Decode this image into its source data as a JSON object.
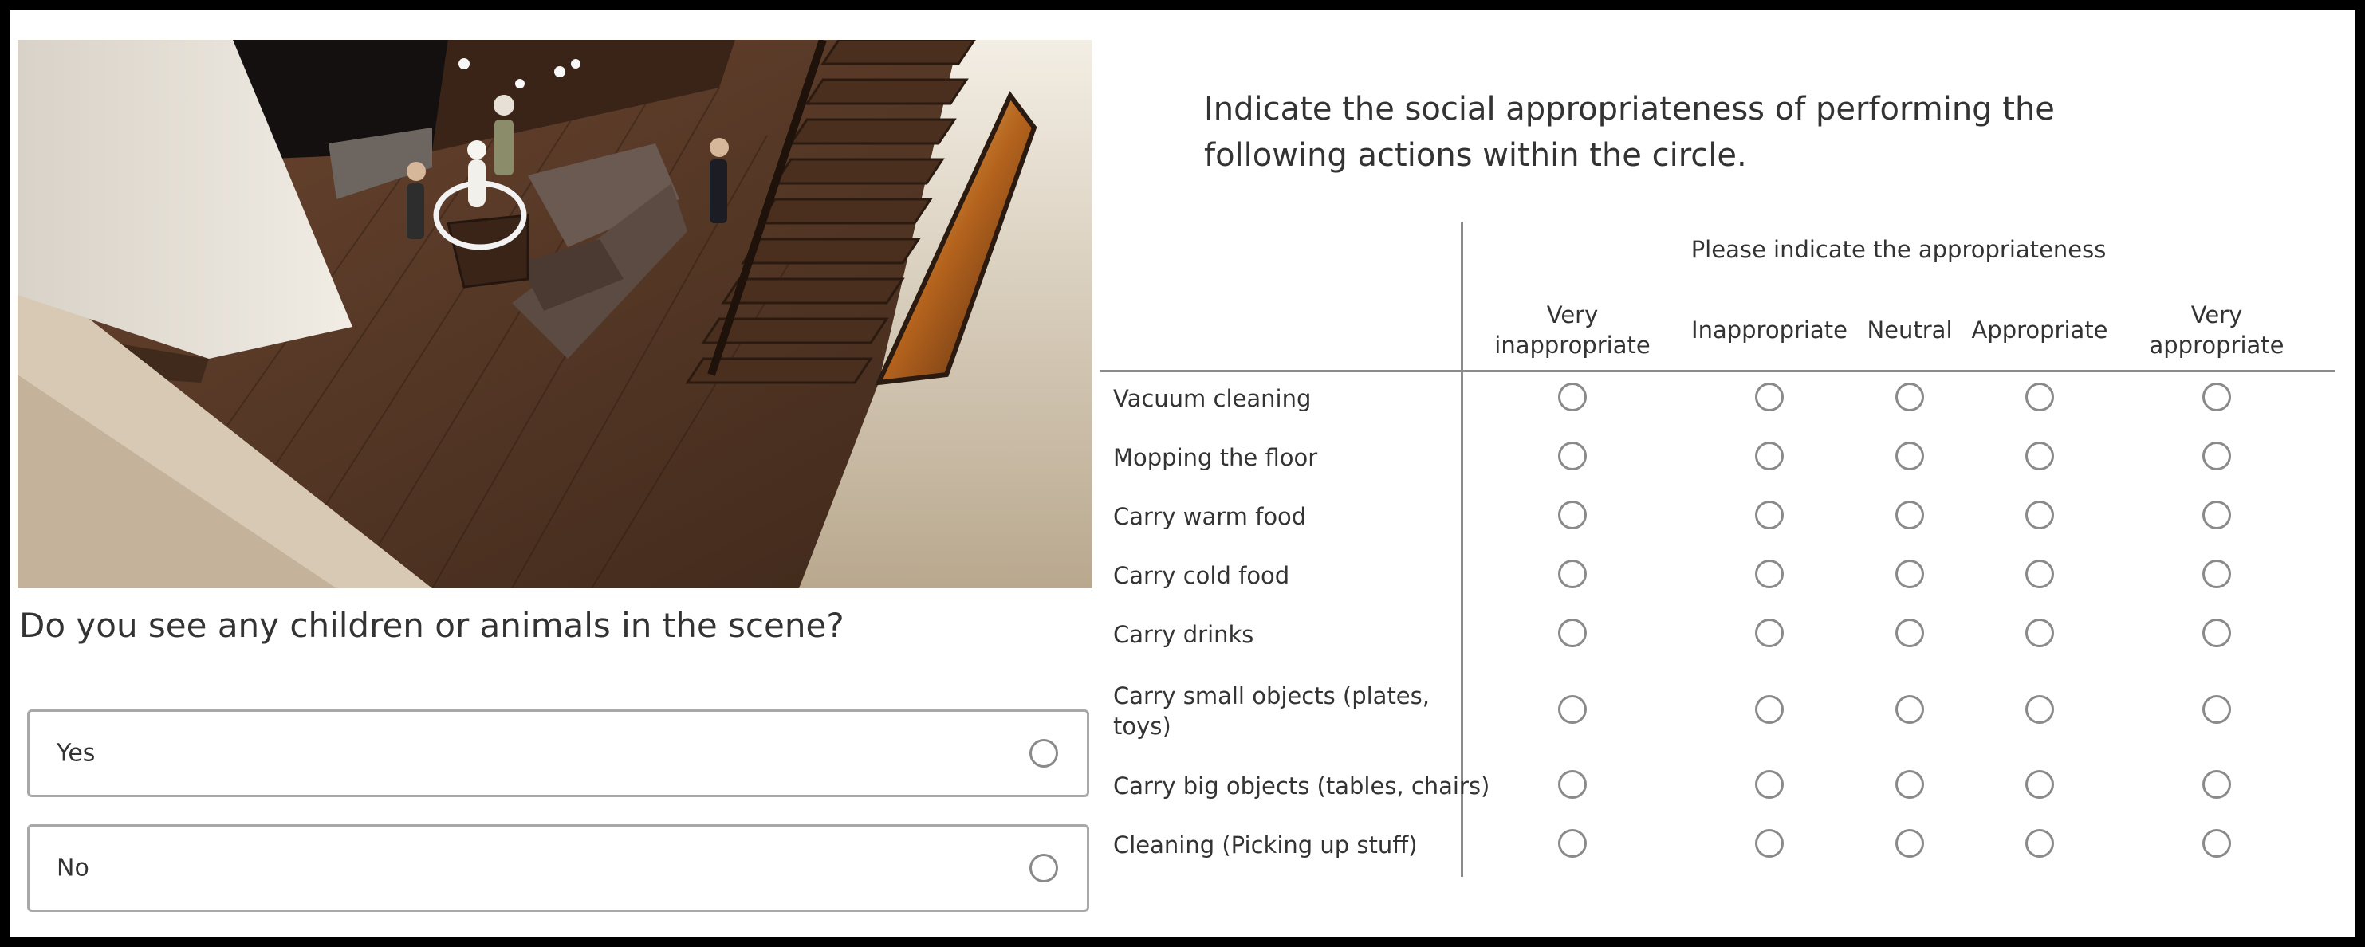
{
  "scene_image": {
    "description_icon": "scene-image"
  },
  "survey": {
    "question": "Do you see any children or animals in the scene?",
    "options": [
      {
        "label": "Yes"
      },
      {
        "label": "No"
      }
    ]
  },
  "matrix": {
    "title": "Indicate the social appropriateness of performing the following actions within the circle.",
    "group_header": "Please indicate the appropriateness",
    "columns": [
      "Very\ninappropriate",
      "Inappropriate",
      "Neutral",
      "Appropriate",
      "Very\nappropriate"
    ],
    "rows": [
      "Vacuum cleaning",
      "Mopping the floor",
      "Carry warm food",
      "Carry cold food",
      "Carry drinks",
      "Carry small objects (plates,\ntoys)",
      "Carry big objects (tables, chairs)",
      "Cleaning (Picking up stuff)"
    ]
  },
  "colors": {
    "text": "#333333",
    "border": "#a8a8a8",
    "radio_border": "#8a8a8a"
  }
}
